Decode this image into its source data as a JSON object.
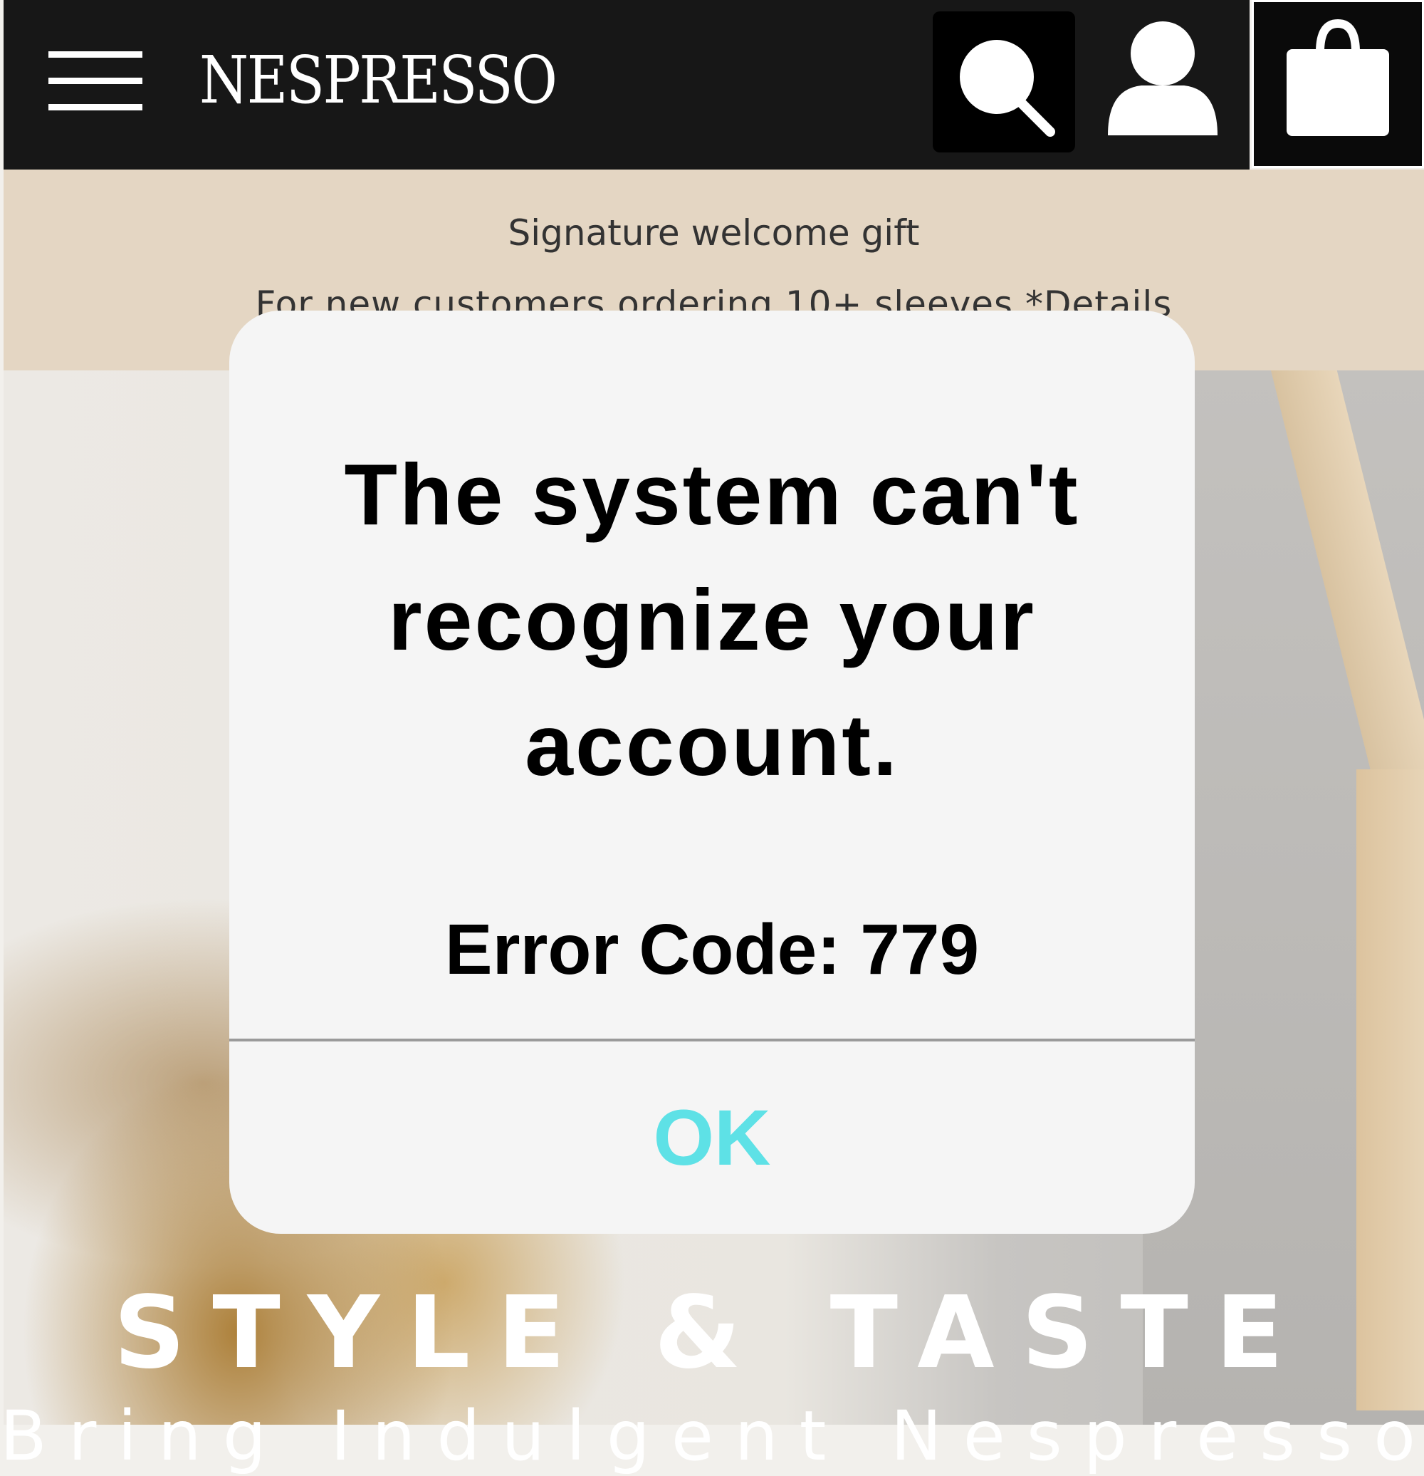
{
  "header": {
    "brand": "NESPRESSO",
    "menu_icon": "hamburger-menu-icon",
    "search_icon": "search-icon",
    "account_icon": "user-icon",
    "cart_icon": "shopping-bag-icon"
  },
  "promo": {
    "line1": "Signature welcome gift",
    "line2": "For new customers ordering 10+ sleeves *Details"
  },
  "hero": {
    "title": "STYLE & TASTE",
    "subtitle": "Bring Indulgent Nespresso"
  },
  "dialog": {
    "message": "The system can't recognize your account.",
    "error_code": "Error Code: 779",
    "ok_label": "OK"
  },
  "colors": {
    "header_bg": "#171717",
    "promo_bg": "#e4d6c3",
    "dialog_bg": "#f5f5f5",
    "ok_accent": "#5ee1e6"
  }
}
